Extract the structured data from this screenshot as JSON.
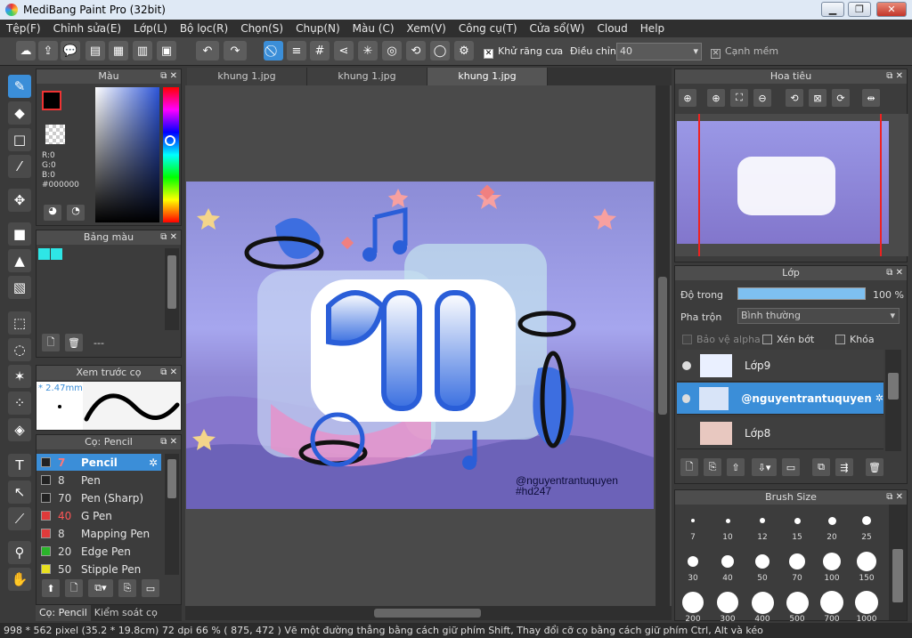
{
  "window": {
    "title": "MediBang Paint Pro (32bit)",
    "minimize": "▁",
    "maximize": "❐",
    "close": "✕"
  },
  "menu": [
    "Tệp(F)",
    "Chỉnh sửa(E)",
    "Lớp(L)",
    "Bộ lọc(R)",
    "Chọn(S)",
    "Chụp(N)",
    "Màu (C)",
    "Xem(V)",
    "Công cụ(T)",
    "Cửa sổ(W)",
    "Cloud",
    "Help"
  ],
  "toolbar": {
    "antialias_label": "Khử răng cưa",
    "adjust_label": "Điều chỉnh",
    "adjust_value": "40",
    "smooth_label": "Cạnh mềm"
  },
  "color_panel": {
    "title": "Màu",
    "r": "R:0",
    "g": "G:0",
    "b": "B:0",
    "hex": "#000000",
    "primary": "#000000",
    "secondary": "#b48ae8"
  },
  "palette_panel": {
    "title": "Bảng màu",
    "swatches": [
      "#2ee6e6",
      "#2ee6e6"
    ],
    "dash": "---"
  },
  "preview_panel": {
    "title": "Xem trước cọ",
    "size": "* 2.47mm"
  },
  "brush_panel": {
    "title": "Cọ: Pencil",
    "items": [
      {
        "num": "7",
        "name": "Pencil",
        "color": "#222222"
      },
      {
        "num": "8",
        "name": "Pen",
        "color": "#222222"
      },
      {
        "num": "70",
        "name": "Pen (Sharp)",
        "color": "#222222"
      },
      {
        "num": "40",
        "name": "G Pen",
        "color": "#e03a3a"
      },
      {
        "num": "8",
        "name": "Mapping Pen",
        "color": "#e03a3a"
      },
      {
        "num": "20",
        "name": "Edge Pen",
        "color": "#2ab52a"
      },
      {
        "num": "50",
        "name": "Stipple Pen",
        "color": "#e8e020"
      }
    ]
  },
  "bottom_tabs": [
    "Cọ: Pencil",
    "Kiểm soát cọ"
  ],
  "doc_tabs": [
    "khung 1.jpg",
    "khung 1.jpg",
    "khung 1.jpg"
  ],
  "art": {
    "watermark_line1": "@nguyentrantuquyen",
    "watermark_line2": "#hd247"
  },
  "navigator": {
    "title": "Hoa tiêu"
  },
  "layers": {
    "title": "Lớp",
    "opacity_label": "Độ trong",
    "opacity_value": "100 %",
    "blend_label": "Pha trộn",
    "blend_value": "Bình thường",
    "protect_alpha": "Bảo vệ alpha",
    "clip": "Xén bớt",
    "lock": "Khóa",
    "items": [
      {
        "name": "Lớp9"
      },
      {
        "name": "@nguyentrantuquyen"
      },
      {
        "name": "Lớp8"
      }
    ]
  },
  "brush_size": {
    "title": "Brush Size",
    "sizes": [
      "7",
      "10",
      "12",
      "15",
      "20",
      "25",
      "30",
      "40",
      "50",
      "70",
      "100",
      "150",
      "200",
      "300",
      "400",
      "500",
      "700",
      "1000"
    ]
  },
  "status": "998 * 562 pixel   (35.2 * 19.8cm)   72 dpi   66 %   ( 875, 472 )   Vẽ một đường thẳng bằng cách giữ phím Shift, Thay đổi cỡ cọ bằng cách giữ phím Ctrl, Alt và kéo"
}
